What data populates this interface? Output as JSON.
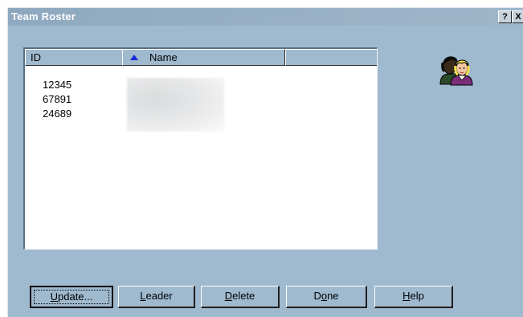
{
  "window": {
    "title": "Team Roster",
    "help_button": "?",
    "close_button": "X"
  },
  "list": {
    "columns": [
      {
        "label": "ID"
      },
      {
        "label": "Name",
        "sorted": "ascending"
      },
      {
        "label": ""
      }
    ],
    "rows": [
      {
        "id": "12345"
      },
      {
        "id": "67891"
      },
      {
        "id": "24689"
      }
    ]
  },
  "icons": {
    "team": "people-icon"
  },
  "buttons": {
    "update": {
      "pre": "",
      "key": "U",
      "post": "pdate..."
    },
    "leader": {
      "pre": "",
      "key": "L",
      "post": "eader"
    },
    "delete": {
      "pre": "",
      "key": "D",
      "post": "elete"
    },
    "done": {
      "pre": "D",
      "key": "o",
      "post": "ne"
    },
    "help": {
      "pre": "",
      "key": "H",
      "post": "elp"
    }
  },
  "colors": {
    "window_bg": "#9fb9cf",
    "sort_arrow": "#1a2bd6"
  }
}
